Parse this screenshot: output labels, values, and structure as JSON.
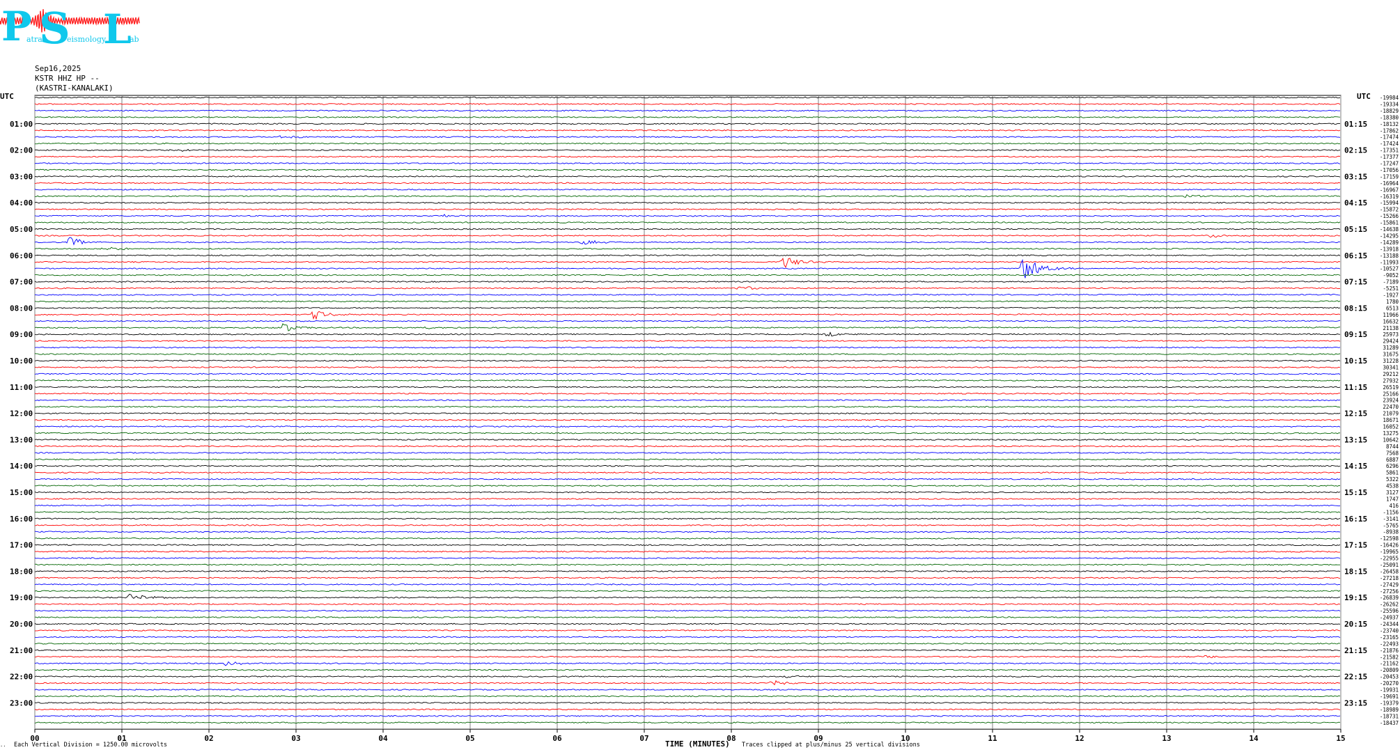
{
  "logo": {
    "letters": [
      "P",
      "S",
      "L"
    ],
    "small_words": [
      "atras",
      "eismology",
      "ab"
    ]
  },
  "header": {
    "date": "Sep16,2025",
    "station": "KSTR HHZ HP --",
    "location": "(KASTRI-KANALAKI)"
  },
  "axes": {
    "left_top": "UTC",
    "right_top": "UTC",
    "x_title": "TIME (MINUTES)",
    "x_ticks": [
      "00",
      "01",
      "02",
      "03",
      "04",
      "05",
      "06",
      "07",
      "08",
      "09",
      "10",
      "11",
      "12",
      "13",
      "14",
      "15"
    ]
  },
  "footer": {
    "left_mark": "..",
    "scale_note": "Each Vertical Division = 1250.00 microvolts",
    "clip_note": "Traces clipped at plus/minus 25 vertical divisions"
  },
  "colors": {
    "trace_cycle": [
      "#000000",
      "#ff0000",
      "#0000ff",
      "#006400"
    ],
    "grid": "#808080"
  },
  "chart_data": {
    "type": "line",
    "title": "",
    "xlabel": "TIME (MINUTES)",
    "xlim": [
      0,
      15
    ],
    "traces_per_hour": 4,
    "trace_count": 96,
    "left_hour_labels": [
      "01:00",
      "02:00",
      "03:00",
      "04:00",
      "05:00",
      "06:00",
      "07:00",
      "08:00",
      "09:00",
      "10:00",
      "11:00",
      "12:00",
      "13:00",
      "14:00",
      "15:00",
      "16:00",
      "17:00",
      "18:00",
      "19:00",
      "20:00",
      "21:00",
      "22:00",
      "23:00"
    ],
    "right_hour_labels": [
      "01:15",
      "02:15",
      "03:15",
      "04:15",
      "05:15",
      "06:15",
      "07:15",
      "08:15",
      "09:15",
      "10:15",
      "11:15",
      "12:15",
      "13:15",
      "14:15",
      "15:15",
      "16:15",
      "17:15",
      "18:15",
      "19:15",
      "20:15",
      "21:15",
      "22:15",
      "23:15"
    ],
    "trace_offsets": [
      -19984,
      -19334,
      -18829,
      -18380,
      -18132,
      -17862,
      -17474,
      -17424,
      -17351,
      -17377,
      -17247,
      -17056,
      -17159,
      -16964,
      -16967,
      -16319,
      -15994,
      -15872,
      -15266,
      -15861,
      -14638,
      -14295,
      -14289,
      -13918,
      -13188,
      -11993,
      -10527,
      -9052,
      -7189,
      -5251,
      -1927,
      1780,
      6513,
      11966,
      16632,
      21138,
      25973,
      29424,
      31289,
      31675,
      31228,
      30341,
      29212,
      27932,
      26519,
      25166,
      23924,
      22470,
      21079,
      18671,
      16052,
      13275,
      10642,
      8744,
      7568,
      6887,
      6296,
      5861,
      5322,
      4538,
      3127,
      1747,
      416,
      -1156,
      -3141,
      -5765,
      -8938,
      -12598,
      -16426,
      -19965,
      -22955,
      -25091,
      -26458,
      -27218,
      -27429,
      -27256,
      -26839,
      -26262,
      -25596,
      -24937,
      -24344,
      -23740,
      -23165,
      -22493,
      -21876,
      -21582,
      -21162,
      -20809,
      -20453,
      -20270,
      -19931,
      -19691,
      -19379,
      -18989,
      -18731,
      -18437
    ],
    "events": [
      {
        "trace": 6,
        "minute": 2.8,
        "amp": 2.5
      },
      {
        "trace": 8,
        "minute": 1.7,
        "amp": 1.5
      },
      {
        "trace": 15,
        "minute": 13.2,
        "amp": 3
      },
      {
        "trace": 18,
        "minute": 4.7,
        "amp": 1.5
      },
      {
        "trace": 22,
        "minute": 0.4,
        "amp": 7
      },
      {
        "trace": 22,
        "minute": 6.3,
        "amp": 4
      },
      {
        "trace": 23,
        "minute": 0.8,
        "amp": 3
      },
      {
        "trace": 21,
        "minute": 13.5,
        "amp": 3
      },
      {
        "trace": 25,
        "minute": 8.6,
        "amp": 9
      },
      {
        "trace": 26,
        "minute": 11.35,
        "amp": 20
      },
      {
        "trace": 29,
        "minute": 8.1,
        "amp": 3.5
      },
      {
        "trace": 33,
        "minute": 3.2,
        "amp": 7
      },
      {
        "trace": 35,
        "minute": 2.85,
        "amp": 7
      },
      {
        "trace": 35,
        "minute": 4.5,
        "amp": 2
      },
      {
        "trace": 36,
        "minute": 9.1,
        "amp": 3
      },
      {
        "trace": 76,
        "minute": 1.1,
        "amp": 6
      },
      {
        "trace": 85,
        "minute": 13.4,
        "amp": 3
      },
      {
        "trace": 86,
        "minute": 2.2,
        "amp": 3
      },
      {
        "trace": 88,
        "minute": 8.6,
        "amp": 2
      },
      {
        "trace": 89,
        "minute": 8.45,
        "amp": 4
      }
    ]
  }
}
